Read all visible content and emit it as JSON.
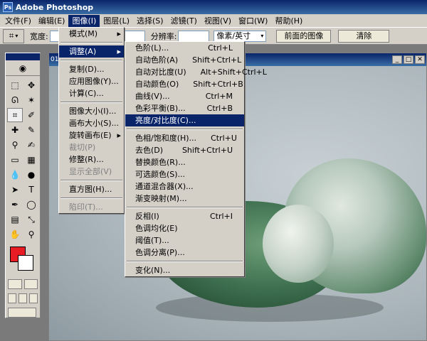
{
  "window": {
    "title": "Adobe Photoshop"
  },
  "menubar": [
    {
      "label": "文件(F)"
    },
    {
      "label": "编辑(E)"
    },
    {
      "label": "图像(I)",
      "active": true
    },
    {
      "label": "图层(L)"
    },
    {
      "label": "选择(S)"
    },
    {
      "label": "滤镜(T)"
    },
    {
      "label": "视图(V)"
    },
    {
      "label": "窗口(W)"
    },
    {
      "label": "帮助(H)"
    }
  ],
  "options": {
    "width_label": "宽度:",
    "resolution_label": "分辨率:",
    "unit_select": "像素/英寸",
    "front_image_button": "前面的图像",
    "clear_button": "清除"
  },
  "doc": {
    "tab_label": "01"
  },
  "image_menu": [
    {
      "label": "模式(M)",
      "submenu": true
    },
    {
      "sep": true
    },
    {
      "label": "调整(A)",
      "submenu": true,
      "highlight": true
    },
    {
      "sep": true
    },
    {
      "label": "复制(D)..."
    },
    {
      "label": "应用图像(Y)..."
    },
    {
      "label": "计算(C)..."
    },
    {
      "sep": true
    },
    {
      "label": "图像大小(I)..."
    },
    {
      "label": "画布大小(S)..."
    },
    {
      "label": "旋转画布(E)",
      "submenu": true
    },
    {
      "label": "裁切(P)",
      "disabled": true
    },
    {
      "label": "修整(R)..."
    },
    {
      "label": "显示全部(V)",
      "disabled": true
    },
    {
      "sep": true
    },
    {
      "label": "直方图(H)..."
    },
    {
      "sep": true
    },
    {
      "label": "陷印(T)...",
      "disabled": true
    }
  ],
  "adjust_menu": [
    {
      "label": "色阶(L)...",
      "shortcut": "Ctrl+L"
    },
    {
      "label": "自动色阶(A)",
      "shortcut": "Shift+Ctrl+L"
    },
    {
      "label": "自动对比度(U)",
      "shortcut": "Alt+Shift+Ctrl+L"
    },
    {
      "label": "自动颜色(O)",
      "shortcut": "Shift+Ctrl+B"
    },
    {
      "label": "曲线(V)...",
      "shortcut": "Ctrl+M"
    },
    {
      "label": "色彩平衡(B)...",
      "shortcut": "Ctrl+B"
    },
    {
      "label": "亮度/对比度(C)...",
      "shortcut": "",
      "highlight": true
    },
    {
      "sep": true
    },
    {
      "label": "色相/饱和度(H)...",
      "shortcut": "Ctrl+U"
    },
    {
      "label": "去色(D)",
      "shortcut": "Shift+Ctrl+U"
    },
    {
      "label": "替换颜色(R)...",
      "shortcut": ""
    },
    {
      "label": "可选颜色(S)...",
      "shortcut": ""
    },
    {
      "label": "通道混合器(X)...",
      "shortcut": ""
    },
    {
      "label": "渐变映射(M)...",
      "shortcut": ""
    },
    {
      "sep": true
    },
    {
      "label": "反相(I)",
      "shortcut": "Ctrl+I"
    },
    {
      "label": "色调均化(E)",
      "shortcut": ""
    },
    {
      "label": "阈值(T)...",
      "shortcut": ""
    },
    {
      "label": "色调分离(P)...",
      "shortcut": ""
    },
    {
      "sep": true
    },
    {
      "label": "变化(N)...",
      "shortcut": ""
    }
  ],
  "colors": {
    "foreground": "#e81c24",
    "background": "#ffffff",
    "highlight": "#0a246a"
  }
}
